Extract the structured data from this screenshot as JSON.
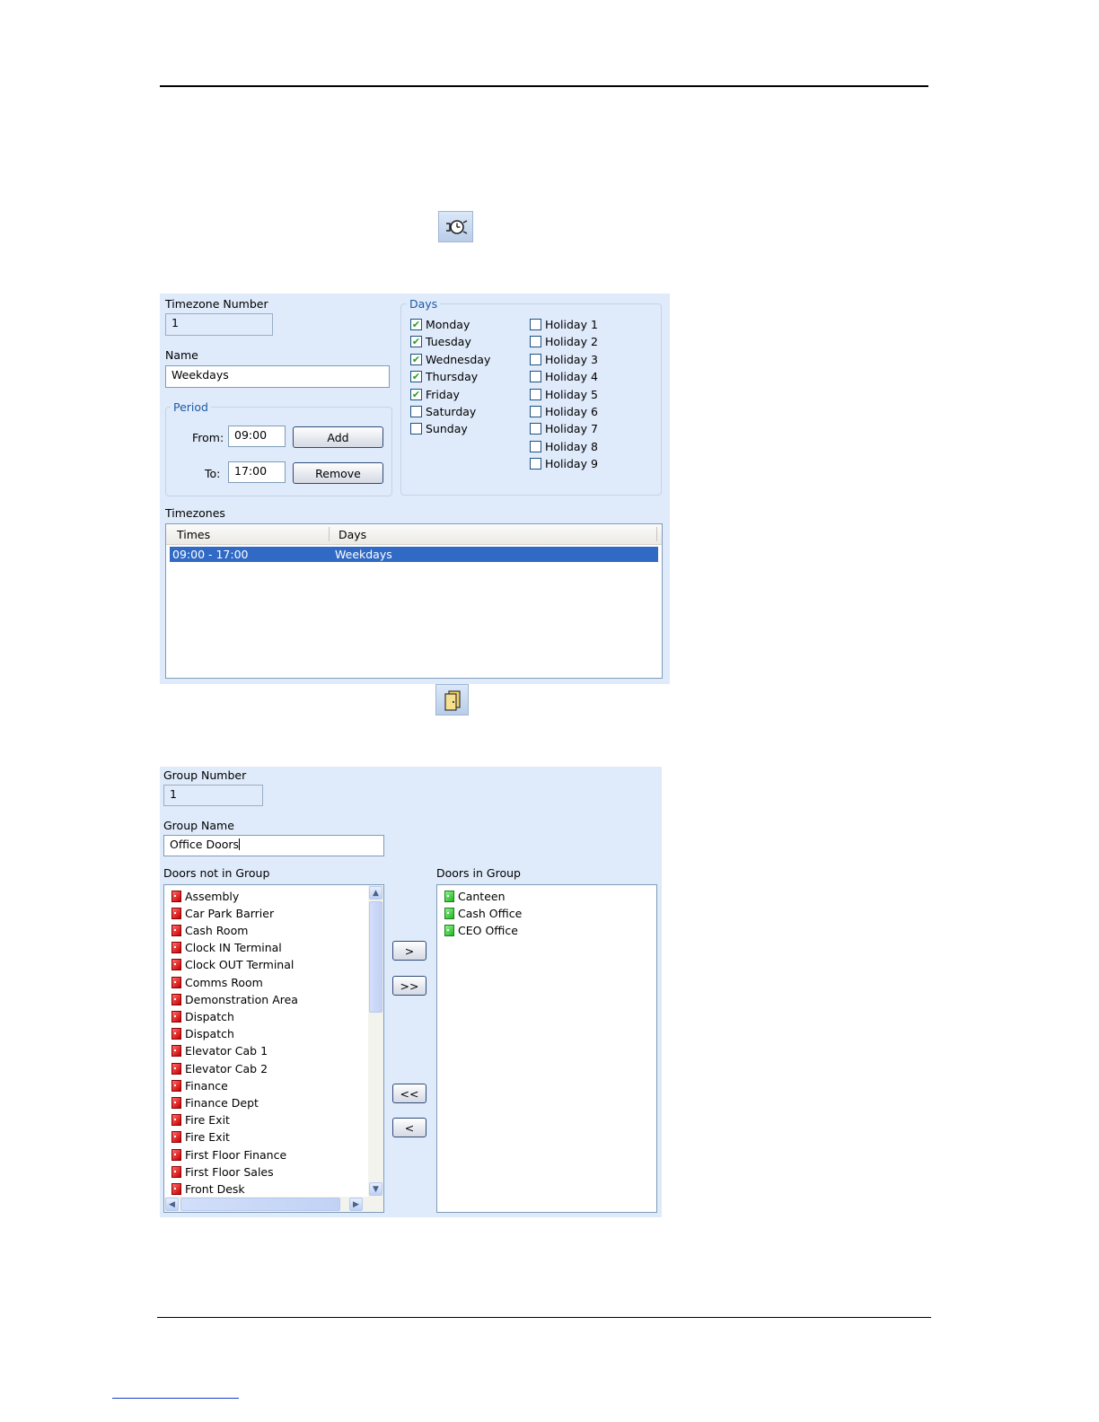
{
  "timezone_window": {
    "number_label": "Timezone Number",
    "number_value": "1",
    "name_label": "Name",
    "name_value": "Weekdays",
    "period_legend": "Period",
    "from_label": "From:",
    "from_value": "09:00",
    "to_label": "To:",
    "to_value": "17:00",
    "add_label": "Add",
    "remove_label": "Remove",
    "days_legend": "Days",
    "days": [
      {
        "label": "Monday",
        "checked": true
      },
      {
        "label": "Tuesday",
        "checked": true
      },
      {
        "label": "Wednesday",
        "checked": true
      },
      {
        "label": "Thursday",
        "checked": true
      },
      {
        "label": "Friday",
        "checked": true
      },
      {
        "label": "Saturday",
        "checked": false
      },
      {
        "label": "Sunday",
        "checked": false
      }
    ],
    "holidays": [
      {
        "label": "Holiday 1",
        "checked": false
      },
      {
        "label": "Holiday 2",
        "checked": false
      },
      {
        "label": "Holiday 3",
        "checked": false
      },
      {
        "label": "Holiday 4",
        "checked": false
      },
      {
        "label": "Holiday 5",
        "checked": false
      },
      {
        "label": "Holiday 6",
        "checked": false
      },
      {
        "label": "Holiday 7",
        "checked": false
      },
      {
        "label": "Holiday 8",
        "checked": false
      },
      {
        "label": "Holiday 9",
        "checked": false
      }
    ],
    "list_label": "Timezones",
    "columns": [
      "Times",
      "Days"
    ],
    "rows": [
      {
        "times": "09:00 - 17:00",
        "days": "Weekdays",
        "selected": true
      }
    ]
  },
  "door_group_window": {
    "number_label": "Group Number",
    "number_value": "1",
    "name_label": "Group Name",
    "name_value": "Office Doors",
    "not_in_group_label": "Doors not in Group",
    "in_group_label": "Doors in Group",
    "doors_not_in_group": [
      "Assembly",
      "Car Park Barrier",
      "Cash Room",
      "Clock IN Terminal",
      "Clock OUT Terminal",
      "Comms Room",
      "Demonstration Area",
      "Dispatch",
      "Dispatch",
      "Elevator Cab 1",
      "Elevator Cab 2",
      "Finance",
      "Finance Dept",
      "Fire Exit",
      "Fire Exit",
      "First Floor Finance",
      "First Floor Sales",
      "Front Desk"
    ],
    "doors_in_group": [
      "Canteen",
      "Cash Office",
      "CEO Office"
    ],
    "move_one_right": ">",
    "move_all_right": ">>",
    "move_all_left": "<<",
    "move_one_left": "<"
  },
  "icons": {
    "timezone_toolbar_icon": "clock-timezone-icon",
    "door_group_toolbar_icon": "door-group-icon",
    "closed_door_color": "#c80000",
    "open_door_color": "#22b522"
  },
  "colors": {
    "panel_bg": "#dfeafa",
    "legend_text": "#1f5aa5",
    "selection": "#316ac5"
  }
}
